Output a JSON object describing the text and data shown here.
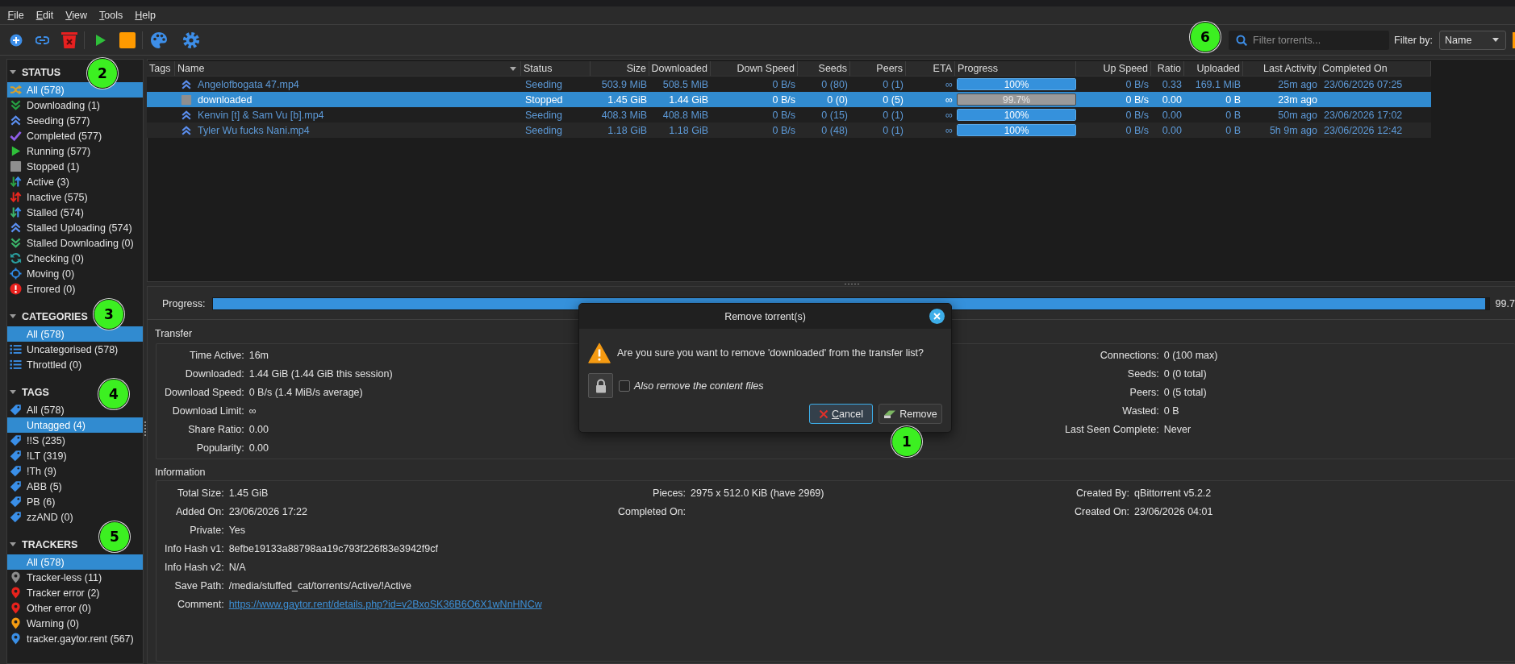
{
  "menu_bar": {
    "items": [
      {
        "label": "File",
        "mnemonic": true
      },
      {
        "label": "Edit",
        "mnemonic": true
      },
      {
        "label": "View",
        "mnemonic": true
      },
      {
        "label": "Tools",
        "mnemonic": true
      },
      {
        "label": "Help",
        "mnemonic": true
      }
    ]
  },
  "filter": {
    "placeholder": "Filter torrents...",
    "marker": "6",
    "filter_by": {
      "label": "Filter by:",
      "value": "Name"
    }
  },
  "sidebar": {
    "sections": [
      {
        "title": "STATUS",
        "expanded": true,
        "marker": "2",
        "items": [
          {
            "label": "All (578)",
            "kind": "all",
            "selected": true
          },
          {
            "label": "Downloading (1)",
            "kind": "downloading",
            "selected": false
          },
          {
            "label": "Seeding (577)",
            "kind": "seeding",
            "selected": false
          },
          {
            "label": "Completed (577)",
            "kind": "completed",
            "selected": false
          },
          {
            "label": "Running (577)",
            "kind": "running",
            "selected": false
          },
          {
            "label": "Stopped (1)",
            "kind": "stopped",
            "selected": false
          },
          {
            "label": "Active (3)",
            "kind": "active",
            "selected": false
          },
          {
            "label": "Inactive (575)",
            "kind": "inactive",
            "selected": false
          },
          {
            "label": "Stalled (574)",
            "kind": "stalled",
            "selected": false
          },
          {
            "label": "Stalled Uploading (574)",
            "kind": "stalled_uploading",
            "selected": false
          },
          {
            "label": "Stalled Downloading (0)",
            "kind": "stalled_downloading",
            "selected": false
          },
          {
            "label": "Checking (0)",
            "kind": "checking",
            "selected": false
          },
          {
            "label": "Moving (0)",
            "kind": "moving",
            "selected": false
          },
          {
            "label": "Errored (0)",
            "kind": "errored",
            "selected": false
          }
        ]
      },
      {
        "title": "CATEGORIES",
        "expanded": true,
        "marker": "3",
        "items": [
          {
            "label": "All (578)",
            "kind": "plain",
            "selected": true
          },
          {
            "label": "Uncategorised (578)",
            "kind": "category",
            "selected": false
          },
          {
            "label": "Throttled (0)",
            "kind": "category",
            "selected": false
          }
        ]
      },
      {
        "title": "TAGS",
        "expanded": true,
        "marker": "4",
        "items": [
          {
            "label": "All (578)",
            "kind": "tag",
            "selected": false
          },
          {
            "label": "Untagged (4)",
            "kind": "plain",
            "selected": true
          },
          {
            "label": "!!S (235)",
            "kind": "tag",
            "selected": false
          },
          {
            "label": "!LT (319)",
            "kind": "tag",
            "selected": false
          },
          {
            "label": "!Th (9)",
            "kind": "tag",
            "selected": false
          },
          {
            "label": "ABB (5)",
            "kind": "tag",
            "selected": false
          },
          {
            "label": "PB (6)",
            "kind": "tag",
            "selected": false
          },
          {
            "label": "zzAND (0)",
            "kind": "tag",
            "selected": false
          }
        ]
      },
      {
        "title": "TRACKERS",
        "expanded": true,
        "marker": "5",
        "items": [
          {
            "label": "All (578)",
            "kind": "plain",
            "selected": true
          },
          {
            "label": "Tracker-less (11)",
            "kind": "tracker",
            "color": "#8c8c8c",
            "selected": false
          },
          {
            "label": "Tracker error (2)",
            "kind": "tracker",
            "color": "#e8221c",
            "selected": false
          },
          {
            "label": "Other error (0)",
            "kind": "tracker",
            "color": "#e8221c",
            "selected": false
          },
          {
            "label": "Warning (0)",
            "kind": "tracker",
            "color": "#f39c12",
            "selected": false
          },
          {
            "label": "tracker.gaytor.rent (567)",
            "kind": "tracker",
            "color": "#3a8fe6",
            "selected": false
          }
        ]
      }
    ]
  },
  "torrent_list": {
    "columns": [
      {
        "label": "Tags",
        "kind": "tags",
        "sorted": false
      },
      {
        "label": "Name",
        "kind": "name",
        "sorted": true
      },
      {
        "label": "Status",
        "kind": "text",
        "sorted": false
      },
      {
        "label": "Size",
        "kind": "number",
        "sorted": false
      },
      {
        "label": "Downloaded",
        "kind": "number",
        "sorted": false
      },
      {
        "label": "Down Speed",
        "kind": "number",
        "sorted": false
      },
      {
        "label": "Seeds",
        "kind": "number",
        "sorted": false
      },
      {
        "label": "Peers",
        "kind": "number",
        "sorted": false
      },
      {
        "label": "ETA",
        "kind": "number",
        "sorted": false
      },
      {
        "label": "Progress",
        "kind": "progress",
        "sorted": false
      },
      {
        "label": "Up Speed",
        "kind": "number",
        "sorted": false
      },
      {
        "label": "Ratio",
        "kind": "number",
        "sorted": false
      },
      {
        "label": "Uploaded",
        "kind": "number",
        "sorted": false
      },
      {
        "label": "Last Activity",
        "kind": "number",
        "sorted": false
      },
      {
        "label": "Completed On",
        "kind": "text",
        "sorted": false
      }
    ],
    "rows": [
      {
        "selected": false,
        "kind": "seeding",
        "cells": [
          "",
          "Angelofbogata 47.mp4",
          "Seeding",
          "503.9 MiB",
          "508.5 MiB",
          "0 B/s",
          "0 (80)",
          "0 (1)",
          "∞",
          {
            "level": 1,
            "text": "100%"
          },
          "0 B/s",
          "0.33",
          "169.1 MiB",
          "25m ago",
          "23/06/2026 07:25"
        ]
      },
      {
        "selected": true,
        "kind": "stopped",
        "cells": [
          "",
          "downloaded",
          "Stopped",
          "1.45 GiB",
          "1.44 GiB",
          "0 B/s",
          "0 (0)",
          "0 (5)",
          "∞",
          {
            "level": 0.997,
            "text": "99.7%"
          },
          "0 B/s",
          "0.00",
          "0 B",
          "23m ago",
          ""
        ]
      },
      {
        "selected": false,
        "kind": "seeding",
        "cells": [
          "",
          "Kenvin [t] & Sam Vu [b].mp4",
          "Seeding",
          "408.3 MiB",
          "408.8 MiB",
          "0 B/s",
          "0 (15)",
          "0 (1)",
          "∞",
          {
            "level": 1,
            "text": "100%"
          },
          "0 B/s",
          "0.00",
          "0 B",
          "50m ago",
          "23/06/2026 17:02"
        ]
      },
      {
        "selected": false,
        "kind": "seeding",
        "cells": [
          "",
          "Tyler Wu fucks Nani.mp4",
          "Seeding",
          "1.18 GiB",
          "1.18 GiB",
          "0 B/s",
          "0 (48)",
          "0 (1)",
          "∞",
          {
            "level": 1,
            "text": "100%"
          },
          "0 B/s",
          "0.00",
          "0 B",
          "5h 9m ago",
          "23/06/2026 12:42"
        ]
      }
    ]
  },
  "details": {
    "progress": {
      "label": "Progress:",
      "level": 0.997,
      "reading": "99.7"
    },
    "sections": [
      {
        "title": "Transfer",
        "columns": [
          [
            {
              "label": "Time Active:",
              "value": "16m"
            },
            {
              "label": "Downloaded:",
              "value": "1.44 GiB (1.44 GiB this session)"
            },
            {
              "label": "Download Speed:",
              "value": "0 B/s (1.4 MiB/s average)"
            },
            {
              "label": "Download Limit:",
              "value": "∞"
            },
            {
              "label": "Share Ratio:",
              "value": "0.00"
            },
            {
              "label": "Popularity:",
              "value": "0.00"
            }
          ],
          [
            {
              "label": "Connections:",
              "value": "0 (100 max)"
            },
            {
              "label": "Seeds:",
              "value": "0 (0 total)"
            },
            {
              "label": "Peers:",
              "value": "0 (5 total)"
            },
            {
              "label": "Wasted:",
              "value": "0 B"
            },
            {
              "label": "Last Seen Complete:",
              "value": "Never"
            }
          ]
        ]
      },
      {
        "title": "Information",
        "columns": [
          [
            {
              "label": "Total Size:",
              "value": "1.45 GiB"
            },
            {
              "label": "Added On:",
              "value": "23/06/2026 17:22"
            },
            {
              "label": "Private:",
              "value": "Yes"
            },
            {
              "label": "Info Hash v1:",
              "value": "8efbe19133a88798aa19c793f226f83e3942f9cf"
            },
            {
              "label": "Info Hash v2:",
              "value": "N/A"
            },
            {
              "label": "Save Path:",
              "value": "/media/stuffed_cat/torrents/Active/!Active"
            },
            {
              "label": "Comment:",
              "link": "https://www.gaytor.rent/details.php?id=v2BxoSK36B6O6X1wNnHNCw"
            }
          ],
          [
            {
              "label": "Pieces:",
              "value": "2975 x 512.0 KiB (have 2969)"
            },
            {
              "label": "Completed On:"
            }
          ],
          [
            {
              "label": "Created By:",
              "value": "qBittorrent v5.2.2"
            },
            {
              "label": "Created On:",
              "value": "23/06/2026 04:01"
            }
          ]
        ]
      }
    ]
  },
  "dialog": {
    "title": "Remove torrent(s)",
    "message": "Are you sure you want to remove 'downloaded' from the transfer list?",
    "checkbox": {
      "label": "Also remove the content files",
      "checked": false
    },
    "buttons": [
      {
        "label": "Cancel",
        "kind": "cancel",
        "focused": true,
        "mnemonic": true
      },
      {
        "label": "Remove",
        "kind": "remove",
        "focused": false,
        "mnemonic": false,
        "marker": "1"
      }
    ]
  }
}
